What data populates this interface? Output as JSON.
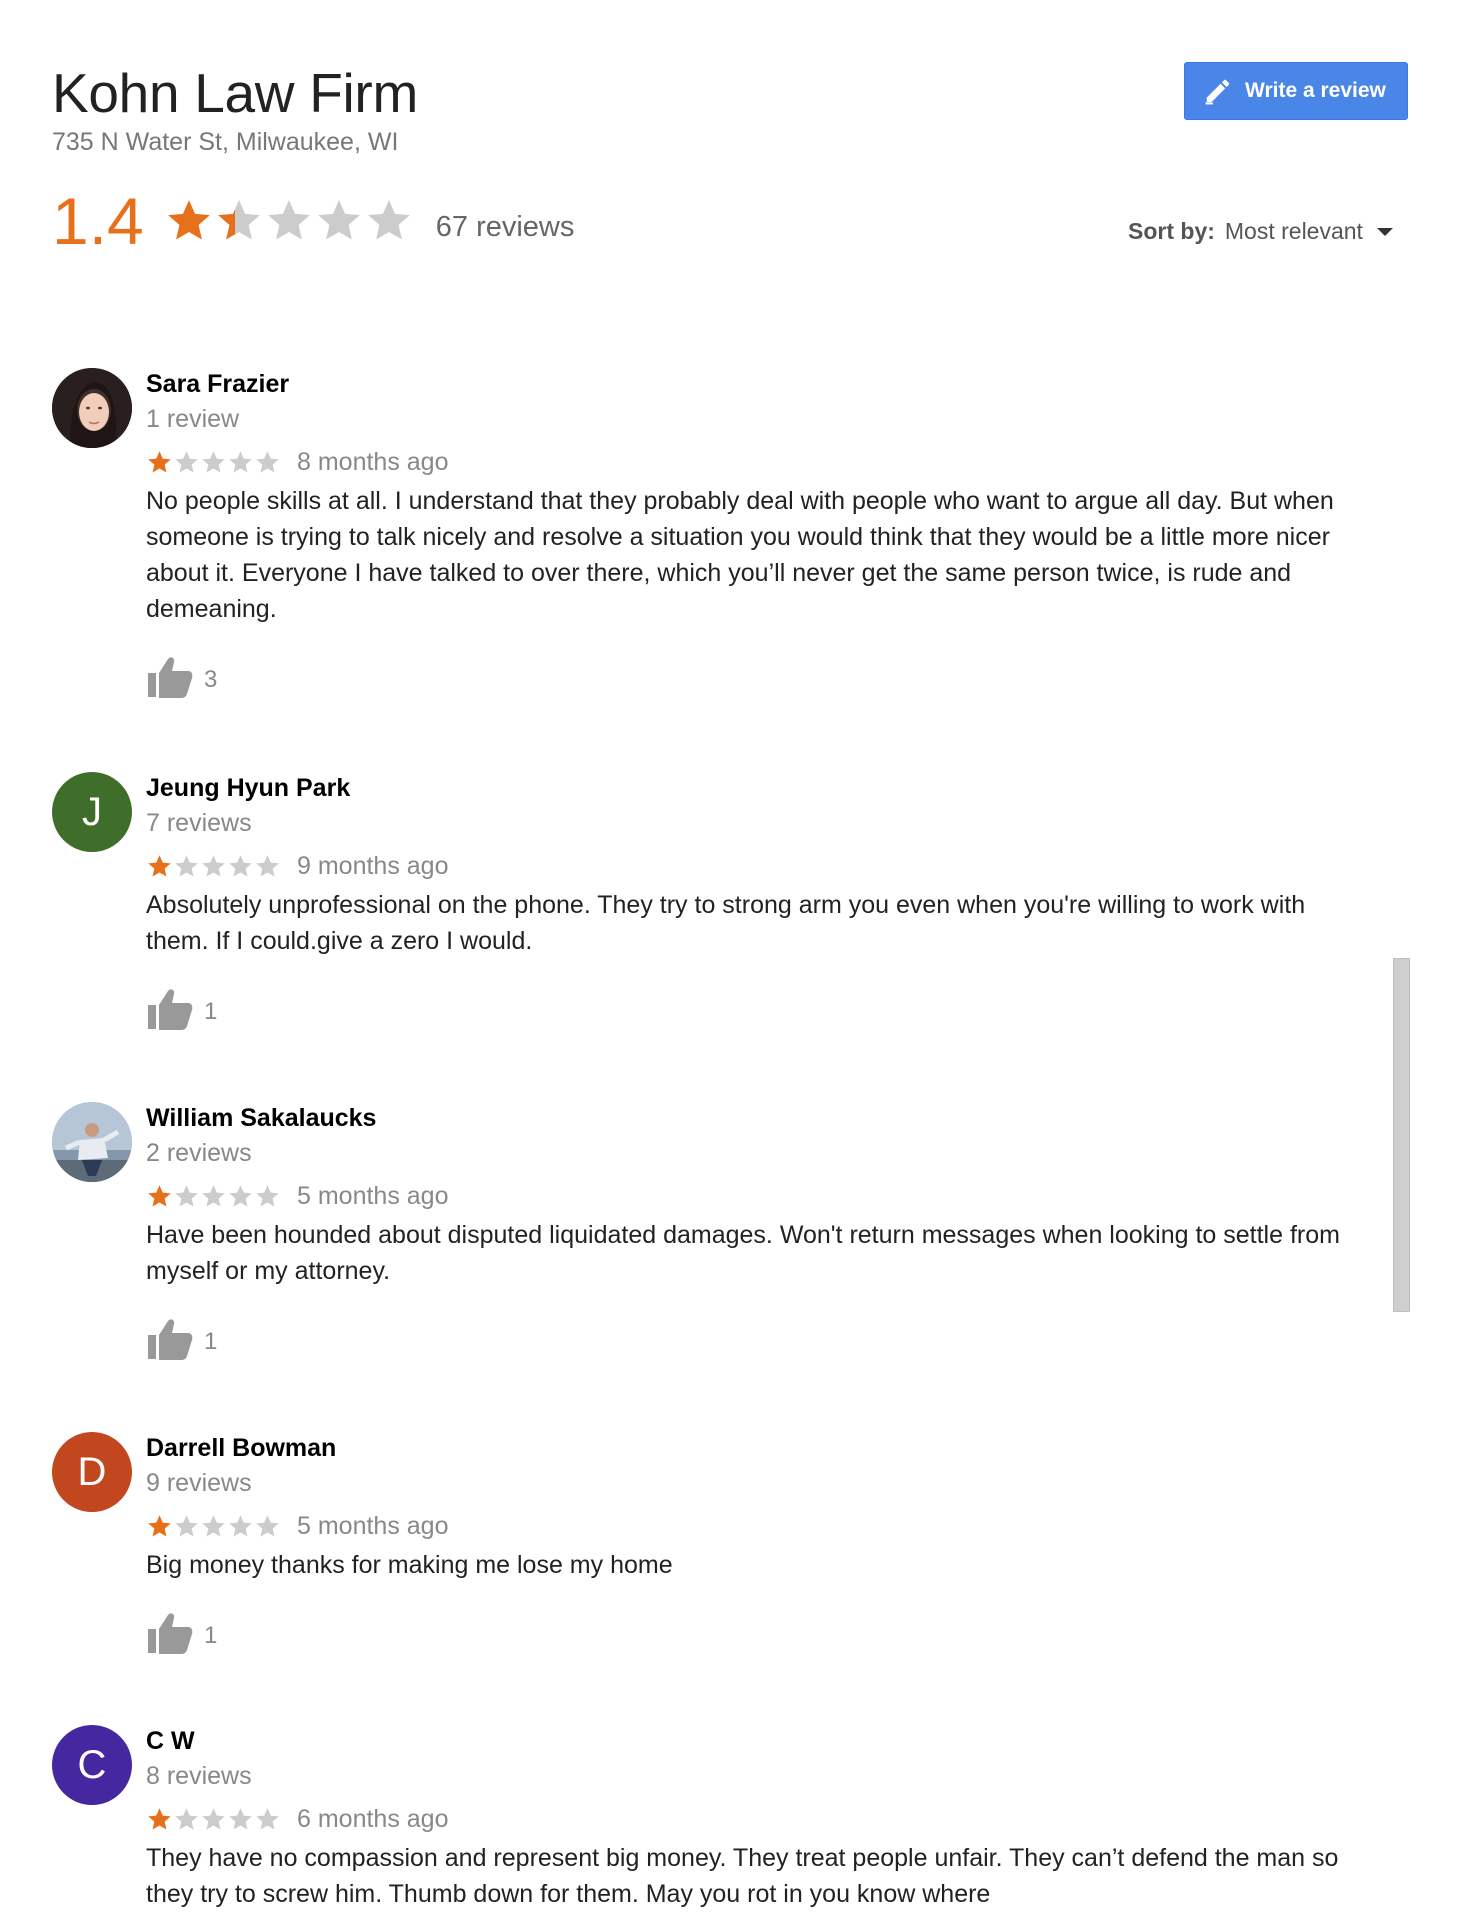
{
  "business": {
    "name": "Kohn Law Firm",
    "address": "735 N Water St, Milwaukee, WI"
  },
  "write_review_label": "Write a review",
  "summary": {
    "rating": "1.4",
    "rating_value": 1.4,
    "review_count_label": "67 reviews"
  },
  "sort": {
    "label": "Sort by:",
    "value": "Most relevant"
  },
  "colors": {
    "accent": "#e7711b",
    "star_empty": "#cccccc",
    "button_blue": "#4a86e8"
  },
  "reviews": [
    {
      "name": "Sara Frazier",
      "count": "1 review",
      "stars": 1,
      "time": "8 months ago",
      "text": "No people skills at all. I understand that they probably deal with people who want to argue all day. But when someone is trying to talk nicely and resolve a situation you would think that they would be a little more nicer about it. Everyone I have talked to over there, which you’ll never get the same person twice, is rude and demeaning.",
      "likes": "3",
      "avatar": "photo-woman",
      "avatar_letter": "",
      "avatar_color": "#3a2a2a"
    },
    {
      "name": "Jeung Hyun Park",
      "count": "7 reviews",
      "stars": 1,
      "time": "9 months ago",
      "text": "Absolutely unprofessional on the phone. They try to strong arm you even when you're willing to work with them. If I could.give a zero I would.",
      "likes": "1",
      "avatar": "letter",
      "avatar_letter": "J",
      "avatar_color": "#3f6e2a"
    },
    {
      "name": "William Sakalaucks",
      "count": "2 reviews",
      "stars": 1,
      "time": "5 months ago",
      "text": "Have been hounded about disputed liquidated damages.  Won't return messages when looking to settle from myself or my attorney.",
      "likes": "1",
      "avatar": "photo-man",
      "avatar_letter": "",
      "avatar_color": "#9fb3c8"
    },
    {
      "name": "Darrell Bowman",
      "count": "9 reviews",
      "stars": 1,
      "time": "5 months ago",
      "text": "Big money thanks for making me lose my home",
      "likes": "1",
      "avatar": "letter",
      "avatar_letter": "D",
      "avatar_color": "#c2461e"
    },
    {
      "name": "C W",
      "count": "8 reviews",
      "stars": 1,
      "time": "6 months ago",
      "text": "They have no compassion and represent big money. They treat people unfair.  They can’t defend the man so they try to screw him. Thumb down for them. May you rot in you know where",
      "likes": "",
      "avatar": "letter",
      "avatar_letter": "C",
      "avatar_color": "#4527a0"
    }
  ]
}
